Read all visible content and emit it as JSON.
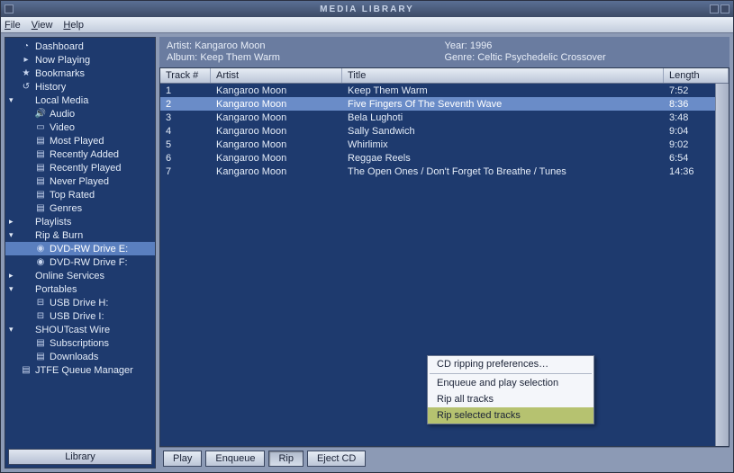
{
  "window": {
    "title": "MEDIA LIBRARY"
  },
  "menu": {
    "file": "File",
    "view": "View",
    "help": "Help"
  },
  "sidebar": {
    "button": "Library",
    "items": [
      {
        "label": "Dashboard",
        "lvl": 0,
        "expand": "",
        "icon": "◔",
        "sel": false
      },
      {
        "label": "Now Playing",
        "lvl": 0,
        "expand": "",
        "icon": "▸",
        "sel": false
      },
      {
        "label": "Bookmarks",
        "lvl": 0,
        "expand": "",
        "icon": "★",
        "sel": false
      },
      {
        "label": "History",
        "lvl": 0,
        "expand": "",
        "icon": "↺",
        "sel": false
      },
      {
        "label": "Local Media",
        "lvl": 0,
        "expand": "▾",
        "icon": "",
        "sel": false
      },
      {
        "label": "Audio",
        "lvl": 1,
        "expand": "",
        "icon": "🔊",
        "sel": false
      },
      {
        "label": "Video",
        "lvl": 1,
        "expand": "",
        "icon": "▭",
        "sel": false
      },
      {
        "label": "Most Played",
        "lvl": 1,
        "expand": "",
        "icon": "▤",
        "sel": false
      },
      {
        "label": "Recently Added",
        "lvl": 1,
        "expand": "",
        "icon": "▤",
        "sel": false
      },
      {
        "label": "Recently Played",
        "lvl": 1,
        "expand": "",
        "icon": "▤",
        "sel": false
      },
      {
        "label": "Never Played",
        "lvl": 1,
        "expand": "",
        "icon": "▤",
        "sel": false
      },
      {
        "label": "Top Rated",
        "lvl": 1,
        "expand": "",
        "icon": "▤",
        "sel": false
      },
      {
        "label": "Genres",
        "lvl": 1,
        "expand": "",
        "icon": "▤",
        "sel": false
      },
      {
        "label": "Playlists",
        "lvl": 0,
        "expand": "▸",
        "icon": "",
        "sel": false
      },
      {
        "label": "Rip & Burn",
        "lvl": 0,
        "expand": "▾",
        "icon": "",
        "sel": false
      },
      {
        "label": "DVD-RW Drive  E:",
        "lvl": 1,
        "expand": "",
        "icon": "◉",
        "sel": true
      },
      {
        "label": "DVD-RW Drive  F:",
        "lvl": 1,
        "expand": "",
        "icon": "◉",
        "sel": false
      },
      {
        "label": "Online Services",
        "lvl": 0,
        "expand": "▸",
        "icon": "",
        "sel": false
      },
      {
        "label": "Portables",
        "lvl": 0,
        "expand": "▾",
        "icon": "",
        "sel": false
      },
      {
        "label": "USB Drive H:",
        "lvl": 1,
        "expand": "",
        "icon": "⊟",
        "sel": false
      },
      {
        "label": "USB Drive I:",
        "lvl": 1,
        "expand": "",
        "icon": "⊟",
        "sel": false
      },
      {
        "label": "SHOUTcast Wire",
        "lvl": 0,
        "expand": "▾",
        "icon": "",
        "sel": false
      },
      {
        "label": "Subscriptions",
        "lvl": 1,
        "expand": "",
        "icon": "▤",
        "sel": false
      },
      {
        "label": "Downloads",
        "lvl": 1,
        "expand": "",
        "icon": "▤",
        "sel": false
      },
      {
        "label": "JTFE Queue Manager",
        "lvl": 0,
        "expand": "",
        "icon": "▤",
        "sel": false
      }
    ]
  },
  "info": {
    "artist_label": "Artist:",
    "artist": "Kangaroo Moon",
    "album_label": "Album:",
    "album": "Keep Them Warm",
    "year_label": "Year:",
    "year": "1996",
    "genre_label": "Genre:",
    "genre": "Celtic Psychedelic Crossover"
  },
  "columns": {
    "track": "Track #",
    "artist": "Artist",
    "title": "Title",
    "length": "Length"
  },
  "tracks": [
    {
      "n": "1",
      "artist": "Kangaroo Moon",
      "title": "Keep Them Warm",
      "len": "7:52",
      "sel": false
    },
    {
      "n": "2",
      "artist": "Kangaroo Moon",
      "title": "Five Fingers Of The Seventh Wave",
      "len": "8:36",
      "sel": true
    },
    {
      "n": "3",
      "artist": "Kangaroo Moon",
      "title": "Bela Lughoti",
      "len": "3:48",
      "sel": false
    },
    {
      "n": "4",
      "artist": "Kangaroo Moon",
      "title": "Sally Sandwich",
      "len": "9:04",
      "sel": false
    },
    {
      "n": "5",
      "artist": "Kangaroo Moon",
      "title": "Whirlimix",
      "len": "9:02",
      "sel": false
    },
    {
      "n": "6",
      "artist": "Kangaroo Moon",
      "title": "Reggae Reels",
      "len": "6:54",
      "sel": false
    },
    {
      "n": "7",
      "artist": "Kangaroo Moon",
      "title": "The Open Ones / Don't Forget To Breathe / Tunes",
      "len": "14:36",
      "sel": false
    }
  ],
  "context": {
    "prefs": "CD ripping preferences…",
    "enqueue": "Enqueue and play selection",
    "rip_all": "Rip all tracks",
    "rip_sel": "Rip selected tracks"
  },
  "buttons": {
    "play": "Play",
    "enqueue": "Enqueue",
    "rip": "Rip",
    "eject": "Eject CD"
  }
}
